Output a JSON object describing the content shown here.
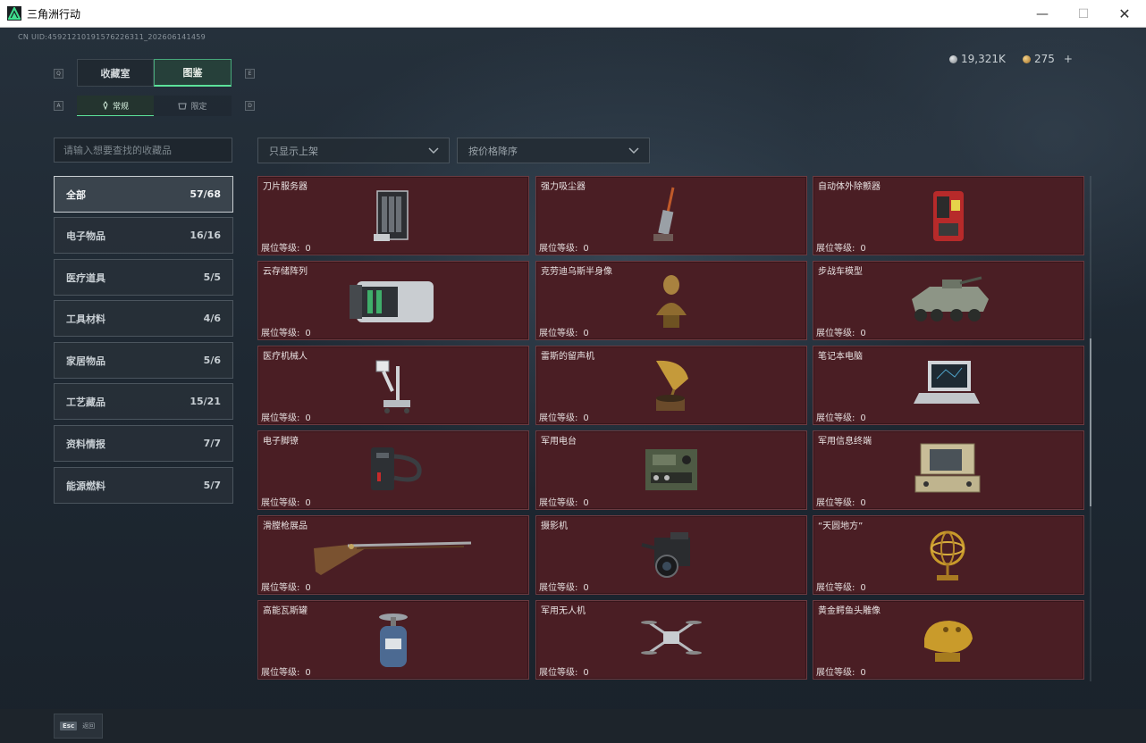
{
  "window": {
    "title": "三角洲行动",
    "minimize": "—",
    "maximize": "☐",
    "close": "✕"
  },
  "header": {
    "uid": "CN UID:4592121019157622631‌1_202606141459",
    "silver": "19,321K",
    "gold": "275",
    "gold_add": "+"
  },
  "tabs": [
    {
      "label": "收藏室",
      "key": "Q"
    },
    {
      "label": "图鉴",
      "key": "E"
    }
  ],
  "subtabs": [
    {
      "label": "常规",
      "key": "A"
    },
    {
      "label": "限定",
      "key": "D"
    }
  ],
  "search": {
    "placeholder": "请输入想要查找的收藏品"
  },
  "filters": {
    "shelf": "只显示上架",
    "sort": "按价格降序"
  },
  "categories": [
    {
      "label": "全部",
      "count": "57/68"
    },
    {
      "label": "电子物品",
      "count": "16/16"
    },
    {
      "label": "医疗道具",
      "count": "5/5"
    },
    {
      "label": "工具材料",
      "count": "4/6"
    },
    {
      "label": "家居物品",
      "count": "5/6"
    },
    {
      "label": "工艺藏品",
      "count": "15/21"
    },
    {
      "label": "资料情报",
      "count": "7/7"
    },
    {
      "label": "能源燃料",
      "count": "5/7"
    }
  ],
  "level_label": "展位等级:",
  "items": [
    {
      "name": "刀片服务器",
      "level": "0",
      "icon": "server-icon"
    },
    {
      "name": "强力吸尘器",
      "level": "0",
      "icon": "vacuum-icon"
    },
    {
      "name": "自动体外除颤器",
      "level": "0",
      "icon": "defibrillator-icon"
    },
    {
      "name": "云存储阵列",
      "level": "0",
      "icon": "storage-array-icon"
    },
    {
      "name": "克劳迪乌斯半身像",
      "level": "0",
      "icon": "bust-icon"
    },
    {
      "name": "步战车模型",
      "level": "0",
      "icon": "ifv-model-icon"
    },
    {
      "name": "医疗机械人",
      "level": "0",
      "icon": "medical-robot-icon"
    },
    {
      "name": "雷斯的留声机",
      "level": "0",
      "icon": "gramophone-icon"
    },
    {
      "name": "笔记本电脑",
      "level": "0",
      "icon": "laptop-icon"
    },
    {
      "name": "电子脚镣",
      "level": "0",
      "icon": "ankle-monitor-icon"
    },
    {
      "name": "军用电台",
      "level": "0",
      "icon": "radio-icon"
    },
    {
      "name": "军用信息终端",
      "level": "0",
      "icon": "terminal-icon"
    },
    {
      "name": "滑膛枪展品",
      "level": "0",
      "icon": "musket-icon"
    },
    {
      "name": "摄影机",
      "level": "0",
      "icon": "camera-icon"
    },
    {
      "name": "“天圆地方”",
      "level": "0",
      "icon": "armillary-sphere-icon"
    },
    {
      "name": "高能瓦斯罐",
      "level": "0",
      "icon": "gas-canister-icon"
    },
    {
      "name": "军用无人机",
      "level": "0",
      "icon": "drone-icon"
    },
    {
      "name": "黄金鳄鱼头雕像",
      "level": "0",
      "icon": "crocodile-head-icon"
    }
  ],
  "footer": {
    "esc_key": "Esc",
    "esc_label": "返回"
  },
  "colors": {
    "card_bg": "#4a1e24",
    "accent_green": "#5ce29a",
    "bg": "#1c2530"
  }
}
